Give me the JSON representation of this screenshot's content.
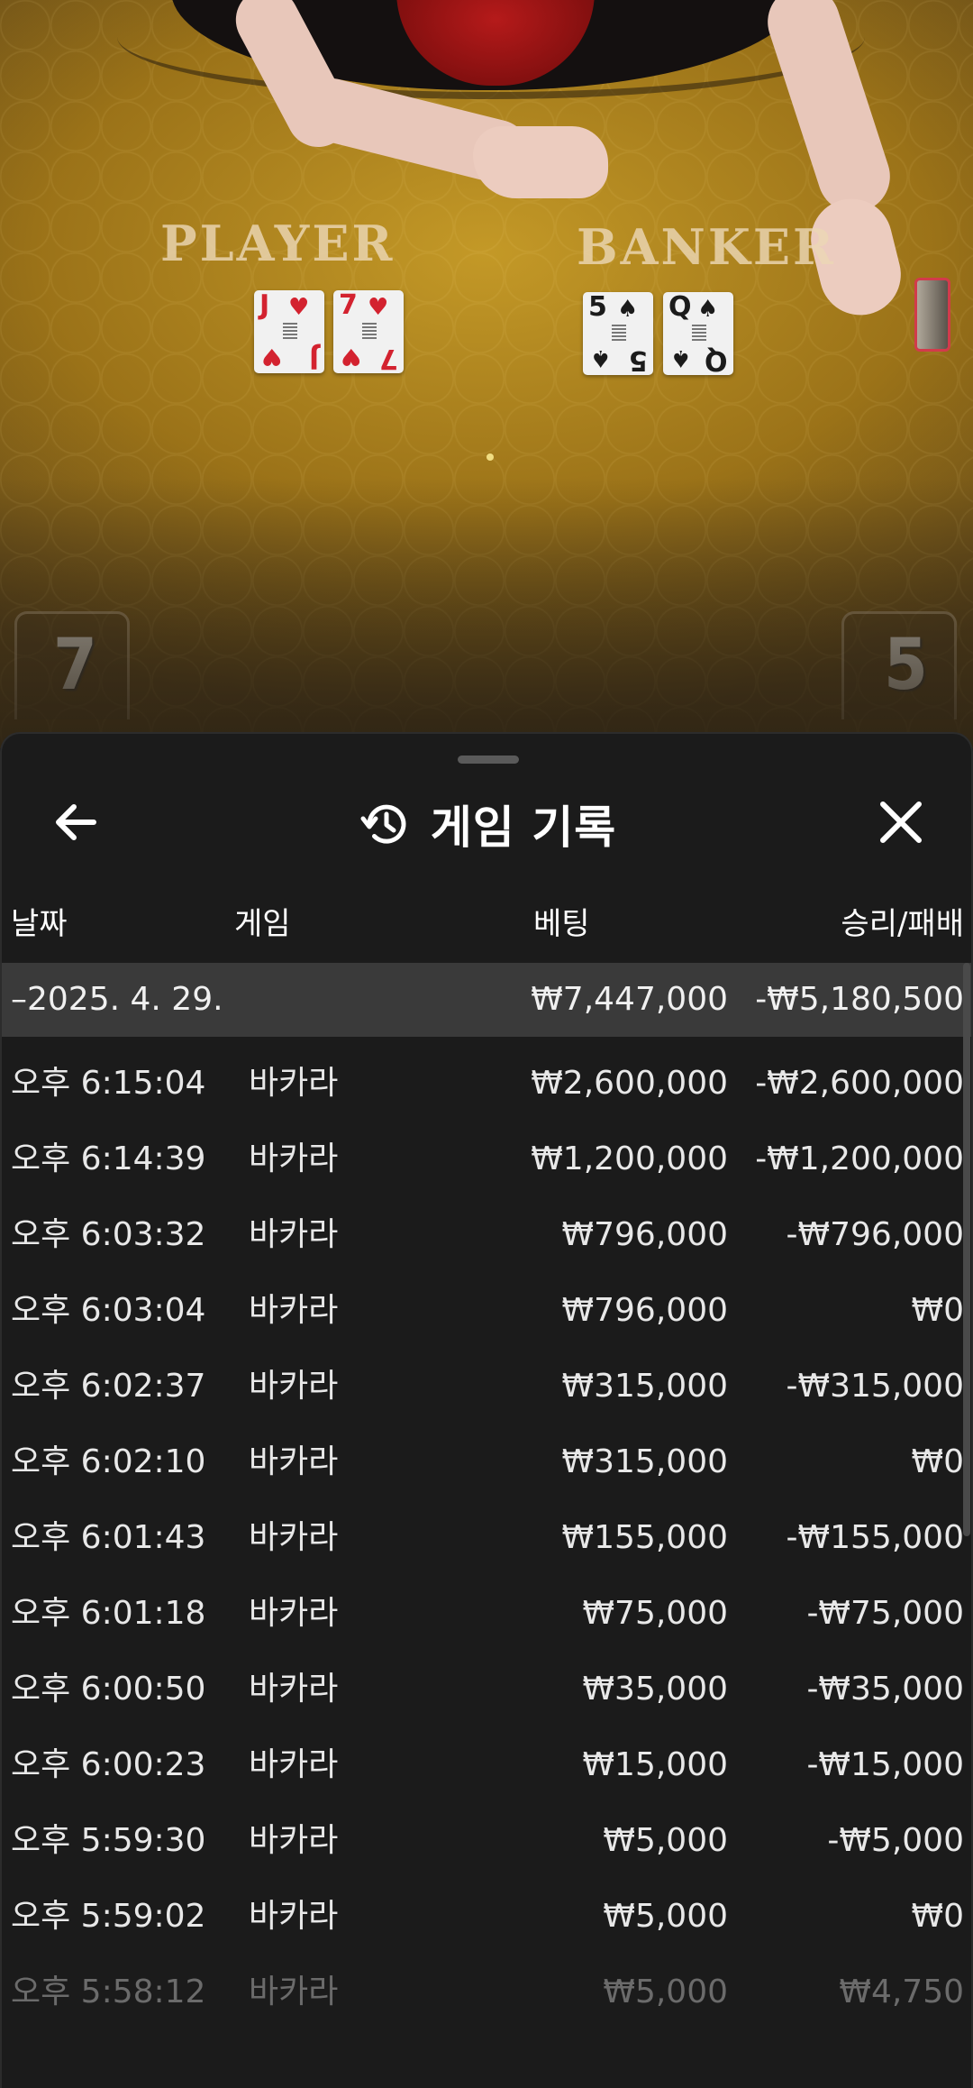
{
  "game_video": {
    "player_label": "PLAYER",
    "banker_label": "BANKER",
    "player_score": "7",
    "banker_score": "5",
    "player_cards": [
      {
        "rank": "J",
        "suit": "♥",
        "color": "red"
      },
      {
        "rank": "7",
        "suit": "♥",
        "color": "red"
      }
    ],
    "banker_cards": [
      {
        "rank": "5",
        "suit": "♠",
        "color": "black"
      },
      {
        "rank": "Q",
        "suit": "♠",
        "color": "black"
      }
    ]
  },
  "sheet": {
    "title": "게임 기록",
    "back_icon": "arrow-left-icon",
    "title_icon": "history-icon",
    "close_icon": "close-icon",
    "columns": {
      "date": "날짜",
      "game": "게임",
      "bet": "베팅",
      "result": "승리/패배"
    },
    "summary": {
      "date": "–2025. 4. 29.",
      "bet": "₩7,447,000",
      "result": "-₩5,180,500"
    },
    "rows": [
      {
        "time": "오후 6:15:04",
        "game": "바카라",
        "bet": "₩2,600,000",
        "result": "-₩2,600,000"
      },
      {
        "time": "오후 6:14:39",
        "game": "바카라",
        "bet": "₩1,200,000",
        "result": "-₩1,200,000"
      },
      {
        "time": "오후 6:03:32",
        "game": "바카라",
        "bet": "₩796,000",
        "result": "-₩796,000"
      },
      {
        "time": "오후 6:03:04",
        "game": "바카라",
        "bet": "₩796,000",
        "result": "₩0"
      },
      {
        "time": "오후 6:02:37",
        "game": "바카라",
        "bet": "₩315,000",
        "result": "-₩315,000"
      },
      {
        "time": "오후 6:02:10",
        "game": "바카라",
        "bet": "₩315,000",
        "result": "₩0"
      },
      {
        "time": "오후 6:01:43",
        "game": "바카라",
        "bet": "₩155,000",
        "result": "-₩155,000"
      },
      {
        "time": "오후 6:01:18",
        "game": "바카라",
        "bet": "₩75,000",
        "result": "-₩75,000"
      },
      {
        "time": "오후 6:00:50",
        "game": "바카라",
        "bet": "₩35,000",
        "result": "-₩35,000"
      },
      {
        "time": "오후 6:00:23",
        "game": "바카라",
        "bet": "₩15,000",
        "result": "-₩15,000"
      },
      {
        "time": "오후 5:59:30",
        "game": "바카라",
        "bet": "₩5,000",
        "result": "-₩5,000"
      },
      {
        "time": "오후 5:59:02",
        "game": "바카라",
        "bet": "₩5,000",
        "result": "₩0"
      },
      {
        "time": "오후 5:58:12",
        "game": "바카라",
        "bet": "₩5,000",
        "result": "₩4,750"
      }
    ]
  }
}
